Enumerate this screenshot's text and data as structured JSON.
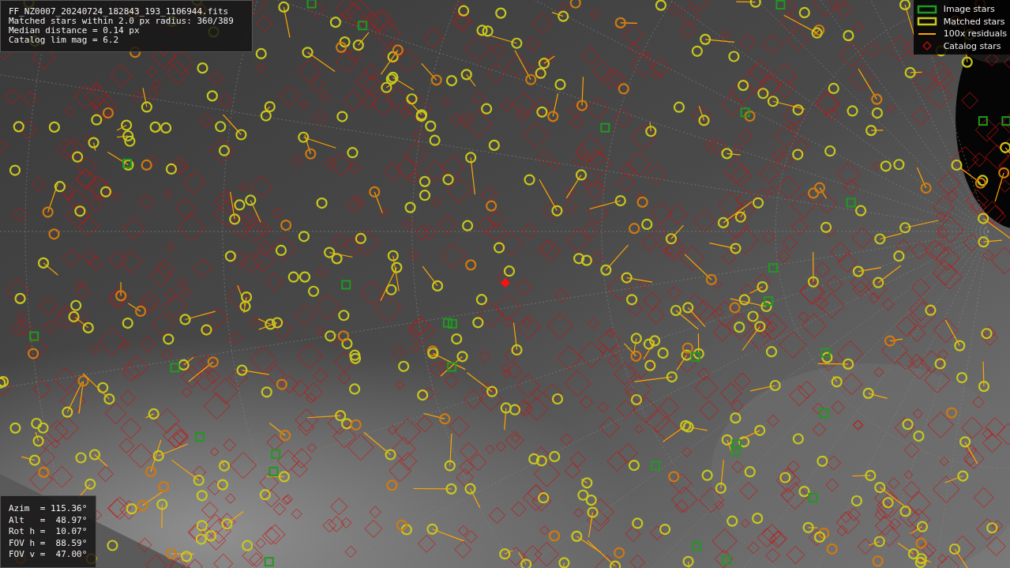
{
  "info_panel": {
    "lines": [
      "FF_NZ0007_20240724_182843_193_1106944.fits",
      "Matched stars within 2.0 px radius: 360/389",
      "Median distance = 0.14 px",
      "Catalog lim mag = 6.2"
    ]
  },
  "legend": {
    "items": [
      {
        "label": "Image stars",
        "kind": "box",
        "color": "#1f9a1f"
      },
      {
        "label": "Matched stars",
        "kind": "box",
        "color": "#c8c81e"
      },
      {
        "label": "100x residuals",
        "kind": "line",
        "color": "#ffa500"
      },
      {
        "label": "Catalog stars",
        "kind": "diamond",
        "color": "#c81010"
      }
    ]
  },
  "pointing_panel": {
    "lines": [
      "Azim  = 115.36°",
      "Alt   =  48.97°",
      "Rot h =  10.07°",
      "FOV h =  88.59°",
      "FOV v =  47.00°"
    ]
  }
}
